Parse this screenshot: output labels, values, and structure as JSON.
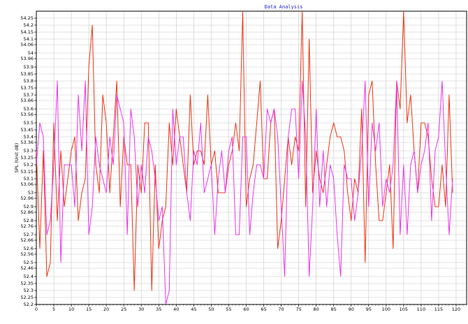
{
  "chart_data": {
    "type": "line",
    "title": "Data Analysis",
    "ylabel": "SPL  (Unit dB)",
    "xlabel": "",
    "xlim": [
      0,
      123
    ],
    "ylim": [
      52.2,
      54.3
    ],
    "grid": true,
    "xticks": [
      "0",
      "5",
      "10",
      "15",
      "20",
      "25",
      "30",
      "35",
      "40",
      "45",
      "50",
      "55",
      "60",
      "65",
      "70",
      "75",
      "80",
      "85",
      "90",
      "95",
      "100",
      "105",
      "110",
      "115",
      "120"
    ],
    "yticks": [
      "52.2",
      "52.25",
      "52.3",
      "52.35",
      "52.4",
      "52.46",
      "52.5",
      "52.56",
      "52.6",
      "52.66",
      "52.7",
      "52.76",
      "52.8",
      "52.86",
      "52.9",
      "52.96",
      "53",
      "53.06",
      "53.1",
      "53.15",
      "53.2",
      "53.25",
      "53.3",
      "53.36",
      "53.4",
      "53.45",
      "53.5",
      "53.56",
      "53.6",
      "53.66",
      "53.7",
      "53.75",
      "53.8",
      "53.85",
      "53.9",
      "53.96",
      "54",
      "54.06",
      "54.1",
      "54.15",
      "54.2",
      "54.25"
    ],
    "series": [
      {
        "color": "#ee3311",
        "values": [
          53.3,
          52.6,
          53.3,
          52.4,
          52.5,
          53.5,
          52.8,
          53.3,
          52.9,
          53.1,
          53.3,
          53.4,
          52.8,
          53.0,
          53.1,
          53.9,
          54.2,
          53.2,
          53.0,
          53.7,
          53.5,
          53.0,
          53.4,
          53.8,
          52.9,
          53.4,
          53.2,
          53.2,
          52.3,
          53.2,
          53.0,
          53.5,
          53.5,
          52.3,
          53.2,
          52.6,
          52.8,
          52.9,
          53.5,
          53.2,
          53.6,
          53.4,
          53.2,
          53.0,
          53.7,
          53.2,
          53.3,
          53.3,
          53.2,
          53.7,
          53.2,
          53.3,
          53.0,
          53.0,
          53.0,
          53.2,
          53.3,
          53.5,
          53.3,
          54.3,
          52.9,
          53.1,
          53.2,
          53.5,
          53.8,
          53.1,
          53.1,
          53.5,
          53.6,
          52.6,
          52.8,
          53.1,
          53.4,
          53.2,
          53.4,
          53.3,
          54.3,
          52.9,
          54.1,
          53.0,
          53.3,
          53.1,
          53.0,
          53.2,
          53.4,
          53.5,
          53.4,
          53.4,
          53.3,
          53.0,
          52.8,
          53.1,
          53.0,
          53.6,
          52.5,
          53.7,
          53.8,
          53.2,
          52.8,
          52.8,
          53.0,
          53.2,
          52.6,
          53.8,
          53.6,
          54.3,
          53.5,
          53.7,
          53.3,
          53.0,
          53.5,
          53.5,
          53.4,
          53.1,
          52.9,
          52.9,
          53.2,
          52.9,
          53.7,
          53.0
        ]
      },
      {
        "color": "#ee33ee",
        "values": [
          53.2,
          53.5,
          53.4,
          52.7,
          52.8,
          53.2,
          53.8,
          52.5,
          53.2,
          53.2,
          53.2,
          52.9,
          53.7,
          53.3,
          53.8,
          52.7,
          52.9,
          53.4,
          53.2,
          53.1,
          53.0,
          53.4,
          53.2,
          53.7,
          53.6,
          53.5,
          52.7,
          53.6,
          53.4,
          52.9,
          53.2,
          53.0,
          53.4,
          53.3,
          53.1,
          52.8,
          52.9,
          52.2,
          52.3,
          53.6,
          53.2,
          53.4,
          53.4,
          53.0,
          52.8,
          53.3,
          53.2,
          53.5,
          53.0,
          53.1,
          53.2,
          52.7,
          53.1,
          53.3,
          53.0,
          53.3,
          53.4,
          52.7,
          52.7,
          53.4,
          53.4,
          52.7,
          53.0,
          53.2,
          53.2,
          53.1,
          53.6,
          53.5,
          53.6,
          53.4,
          52.9,
          52.4,
          53.4,
          53.6,
          53.6,
          53.1,
          53.8,
          53.4,
          52.4,
          52.9,
          53.6,
          52.9,
          53.3,
          52.9,
          53.2,
          53.1,
          52.7,
          52.4,
          53.2,
          53.1,
          53.1,
          52.8,
          53.0,
          53.3,
          53.8,
          52.9,
          53.5,
          53.3,
          53.5,
          52.9,
          53.1,
          53.0,
          53.2,
          53.8,
          52.7,
          53.2,
          52.7,
          53.2,
          53.3,
          53.0,
          53.2,
          53.3,
          53.5,
          52.8,
          53.3,
          53.4,
          53.8,
          53.2,
          52.7,
          53.1
        ]
      }
    ]
  }
}
